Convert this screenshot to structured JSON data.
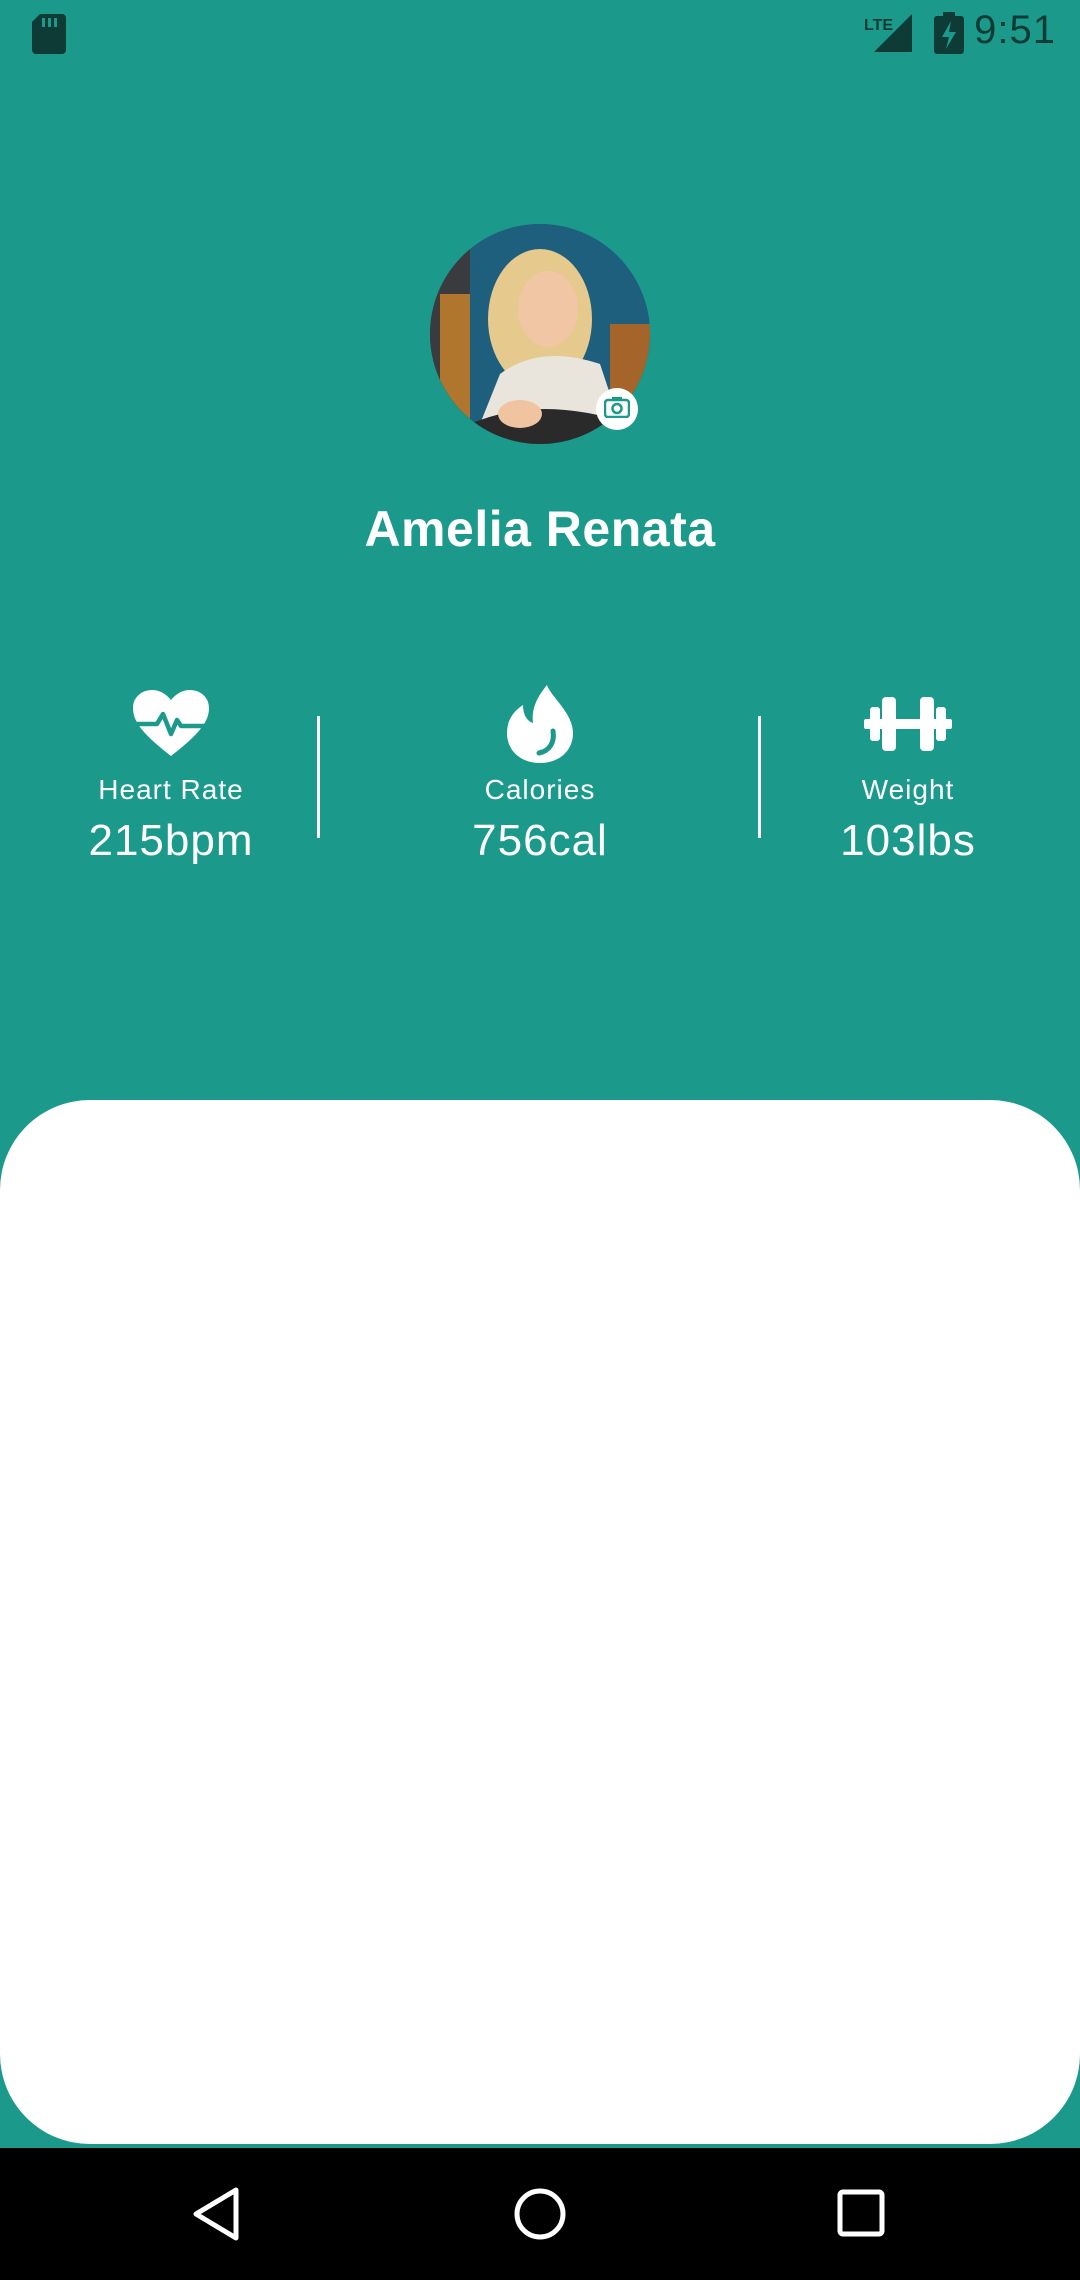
{
  "status_bar": {
    "time": "9:51",
    "network": "LTE",
    "icons": [
      "sd-card-icon",
      "lte-signal-icon",
      "battery-charging-icon"
    ]
  },
  "profile": {
    "name": "Amelia Renata",
    "avatar_icon": "avatar-photo",
    "badge_icon": "camera-icon"
  },
  "stats": [
    {
      "icon": "heart-rate-icon",
      "label": "Heart Rate",
      "value": "215bpm"
    },
    {
      "icon": "flame-icon",
      "label": "Calories",
      "value": "756cal"
    },
    {
      "icon": "dumbbell-icon",
      "label": "Weight",
      "value": "103lbs"
    }
  ],
  "nav_bar": {
    "buttons": [
      "back-icon",
      "home-icon",
      "recents-icon"
    ]
  },
  "colors": {
    "primary": "#1b9a8c",
    "surface": "#ffffff",
    "status_icons": "#0f3b36",
    "nav_background": "#000000"
  }
}
